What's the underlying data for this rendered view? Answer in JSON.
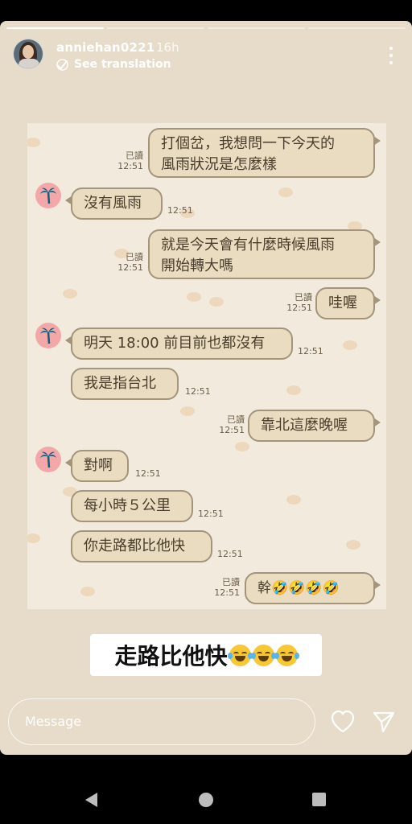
{
  "story": {
    "username": "anniehan0221",
    "time": "16h",
    "see_translation": "See translation",
    "progress_segments": 4,
    "progress_done": 1
  },
  "chat": {
    "messages": [
      {
        "side": "right",
        "lines": [
          "打個岔，我想問一下今天的",
          "風雨狀況是怎麼樣"
        ],
        "read": "已讀",
        "time": "12:51"
      },
      {
        "side": "left",
        "lines": [
          "沒有風雨"
        ],
        "time": "12:51"
      },
      {
        "side": "right",
        "lines": [
          "就是今天會有什麼時候風雨",
          "開始轉大嗎"
        ],
        "read": "已讀",
        "time": "12:51"
      },
      {
        "side": "right",
        "lines": [
          "哇喔"
        ],
        "read": "已讀",
        "time": "12:51"
      },
      {
        "side": "left",
        "lines": [
          "明天 18:00 前目前也都沒有"
        ],
        "time": "12:51"
      },
      {
        "side": "left",
        "lines": [
          "我是指台北"
        ],
        "time": "12:51"
      },
      {
        "side": "right",
        "lines": [
          "靠北這麼晚喔"
        ],
        "read": "已讀",
        "time": "12:51"
      },
      {
        "side": "left",
        "lines": [
          "對啊"
        ],
        "time": "12:51"
      },
      {
        "side": "left",
        "lines": [
          "每小時５公里"
        ],
        "time": "12:51"
      },
      {
        "side": "left",
        "lines": [
          "你走路都比他快"
        ],
        "time": "12:51"
      },
      {
        "side": "right",
        "lines": [
          "幹🤣🤣🤣🤣"
        ],
        "read": "已讀",
        "time": "12:51"
      }
    ]
  },
  "caption": {
    "text": "走路比他快",
    "emoji": "😂😂😂"
  },
  "reply": {
    "placeholder": "Message"
  },
  "icons": {
    "like": "heart-icon",
    "share": "send-icon",
    "more": "more-vertical-icon"
  },
  "colors": {
    "bubble": "#e9dcc0",
    "bubble_border": "#a3947b",
    "chat_avatar": "#f3a7a8",
    "background": "#e6dcc9"
  }
}
